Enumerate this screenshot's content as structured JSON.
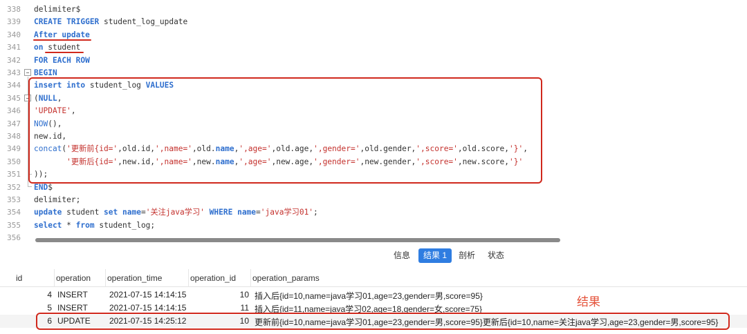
{
  "editor": {
    "lines": [
      {
        "num": "338",
        "html": "delimiter$"
      },
      {
        "num": "339",
        "html": "<span class='kw'>CREATE TRIGGER</span> student_log_update"
      },
      {
        "num": "340",
        "html": "<span class='kw'>After update</span>"
      },
      {
        "num": "341",
        "html": "<span class='kw'>on</span> student"
      },
      {
        "num": "342",
        "html": "<span class='kw'>FOR EACH ROW</span>"
      },
      {
        "num": "343",
        "html": "<span class='kw'>BEGIN</span>"
      },
      {
        "num": "344",
        "html": "<span class='kw'>insert into</span> student_log <span class='kw'>VALUES</span>"
      },
      {
        "num": "345",
        "html": "(<span class='kw'>NULL</span>,"
      },
      {
        "num": "346",
        "html": "<span class='str'>'UPDATE'</span>,"
      },
      {
        "num": "347",
        "html": "<span class='fn'>NOW</span>(),"
      },
      {
        "num": "348",
        "html": "new.id,"
      },
      {
        "num": "349",
        "html": "<span class='fn'>concat</span>(<span class='str'>'更新前{id='</span>,old.id,<span class='str'>',name='</span>,old.<span class='field'>name</span>,<span class='str'>',age='</span>,old.age,<span class='str'>',gender='</span>,old.gender,<span class='str'>',score='</span>,old.score,<span class='str'>'}'</span>,"
      },
      {
        "num": "350",
        "html": "       <span class='str'>'更新后{id='</span>,new.id,<span class='str'>',name='</span>,new.<span class='field'>name</span>,<span class='str'>',age='</span>,new.age,<span class='str'>',gender='</span>,new.gender,<span class='str'>',score='</span>,new.score,<span class='str'>'}'</span>"
      },
      {
        "num": "351",
        "html": "));"
      },
      {
        "num": "352",
        "html": "<span class='kw'>END</span>$"
      },
      {
        "num": "353",
        "html": "delimiter;"
      },
      {
        "num": "354",
        "html": "<span class='kw'>update</span> student <span class='kw'>set</span> <span class='kw'>name</span>=<span class='str'>'关注java学习'</span> <span class='kw'>WHERE</span> <span class='kw'>name</span>=<span class='str'>'java学习01'</span>;"
      },
      {
        "num": "355",
        "html": "<span class='kw'>select</span> * <span class='kw'>from</span> student_log;"
      },
      {
        "num": "356",
        "html": ""
      }
    ]
  },
  "tabs": [
    {
      "label": "信息",
      "active": false
    },
    {
      "label": "结果 1",
      "active": true
    },
    {
      "label": "剖析",
      "active": false
    },
    {
      "label": "状态",
      "active": false
    }
  ],
  "grid": {
    "columns": [
      "id",
      "operation",
      "operation_time",
      "operation_id",
      "operation_params"
    ],
    "rows": [
      [
        "4",
        "INSERT",
        "2021-07-15 14:14:15",
        "10",
        "插入后{id=10,name=java学习01,age=23,gender=男,score=95}"
      ],
      [
        "5",
        "INSERT",
        "2021-07-15 14:14:15",
        "11",
        "插入后{id=11,name=java学习02,age=18,gender=女,score=75}"
      ],
      [
        "6",
        "UPDATE",
        "2021-07-15 14:25:12",
        "10",
        "更新前{id=10,name=java学习01,age=23,gender=男,score=95}更新后{id=10,name=关注java学习,age=23,gender=男,score=95}"
      ]
    ]
  },
  "annotation": {
    "result_label": "结果"
  },
  "colors": {
    "keyword": "#2f6fce",
    "string": "#c4312d",
    "highlight": "#d0281c",
    "active_tab": "#2f7de1"
  }
}
